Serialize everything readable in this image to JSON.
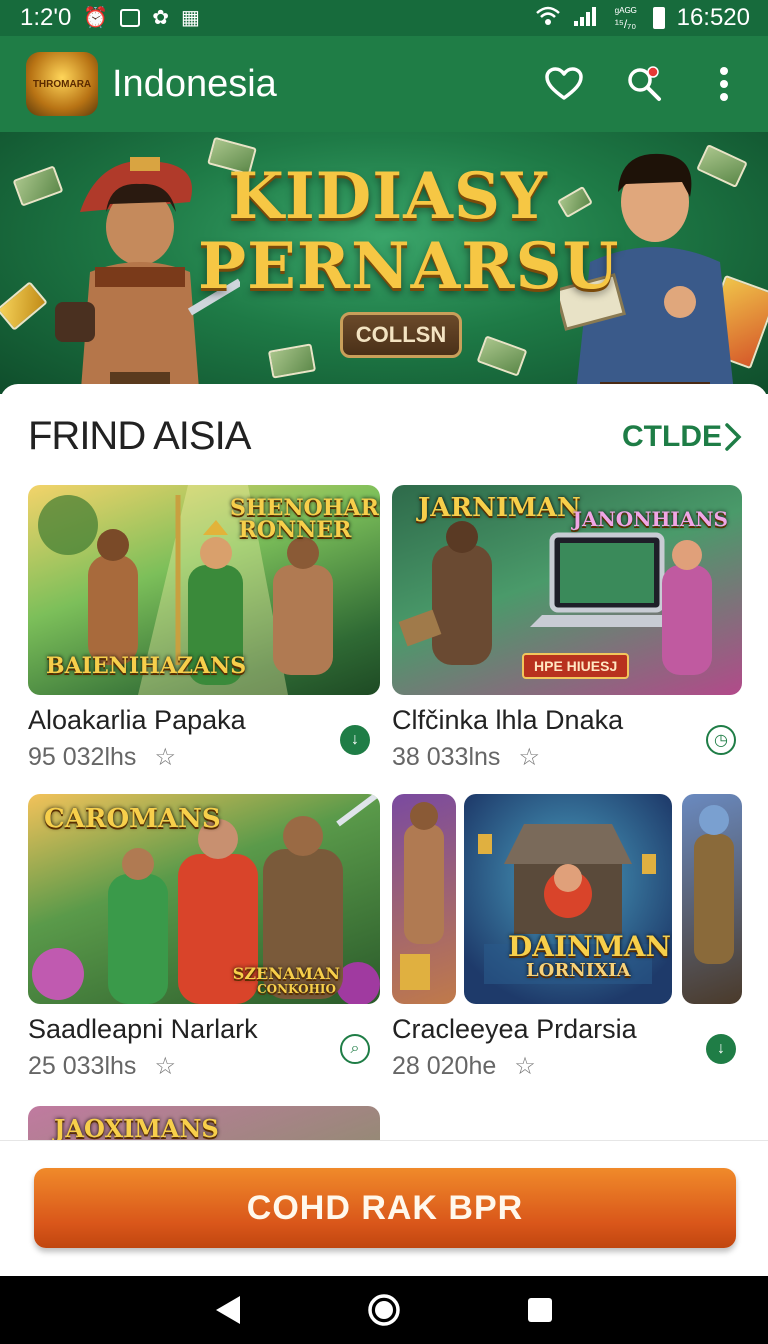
{
  "status_bar": {
    "time_left": "1:2'0",
    "signal_text": "ᵍᴬᴳᴳ ¹⁵/₇₀",
    "time_right": "16:520"
  },
  "app_bar": {
    "logo_text": "THROMARA",
    "title": "Indonesia",
    "actions": [
      "heart-icon",
      "search-icon",
      "more-icon"
    ]
  },
  "hero": {
    "title_line1": "KIDIASY",
    "title_line2": "PERNARSU",
    "badge": "COLLSN"
  },
  "section": {
    "title": "FRIND AISIA",
    "link": "CTLDE"
  },
  "games": [
    {
      "name": "Aloakarlia Papaka",
      "meta": "95 032lhs",
      "art_title": "SHENOHARS RONNER",
      "art_subtitle": "BAIENIHAZANS",
      "status_icon": "download-filled-icon"
    },
    {
      "name": "Clfčinka lhla Dnaka",
      "meta": "38 033lns",
      "art_title": "JARNIMAN",
      "art_subtitle": "JANONHIANS",
      "art_tag": "HPE HIUESJ",
      "status_icon": "clock-outline-icon"
    },
    {
      "name": "Saadleapni Narlark",
      "meta": "25 033lhs",
      "art_title": "CAROMANS",
      "art_subtitle": "SZENAMAN",
      "art_tag": "CONKOHIO",
      "status_icon": "search-outline-icon"
    },
    {
      "name": "Cracleeyea Prdarsia",
      "meta": "28 020he",
      "art_title": "DAINMAN",
      "art_subtitle": "LORNIXIA",
      "status_icon": "download-filled-icon"
    },
    {
      "art_title": "JAOXIMANS"
    }
  ],
  "cta": {
    "label": "COHD RAK BPR"
  },
  "colors": {
    "brand_green": "#1f7d46",
    "status_green": "#176b3c",
    "cta_orange": "#e0621c"
  }
}
